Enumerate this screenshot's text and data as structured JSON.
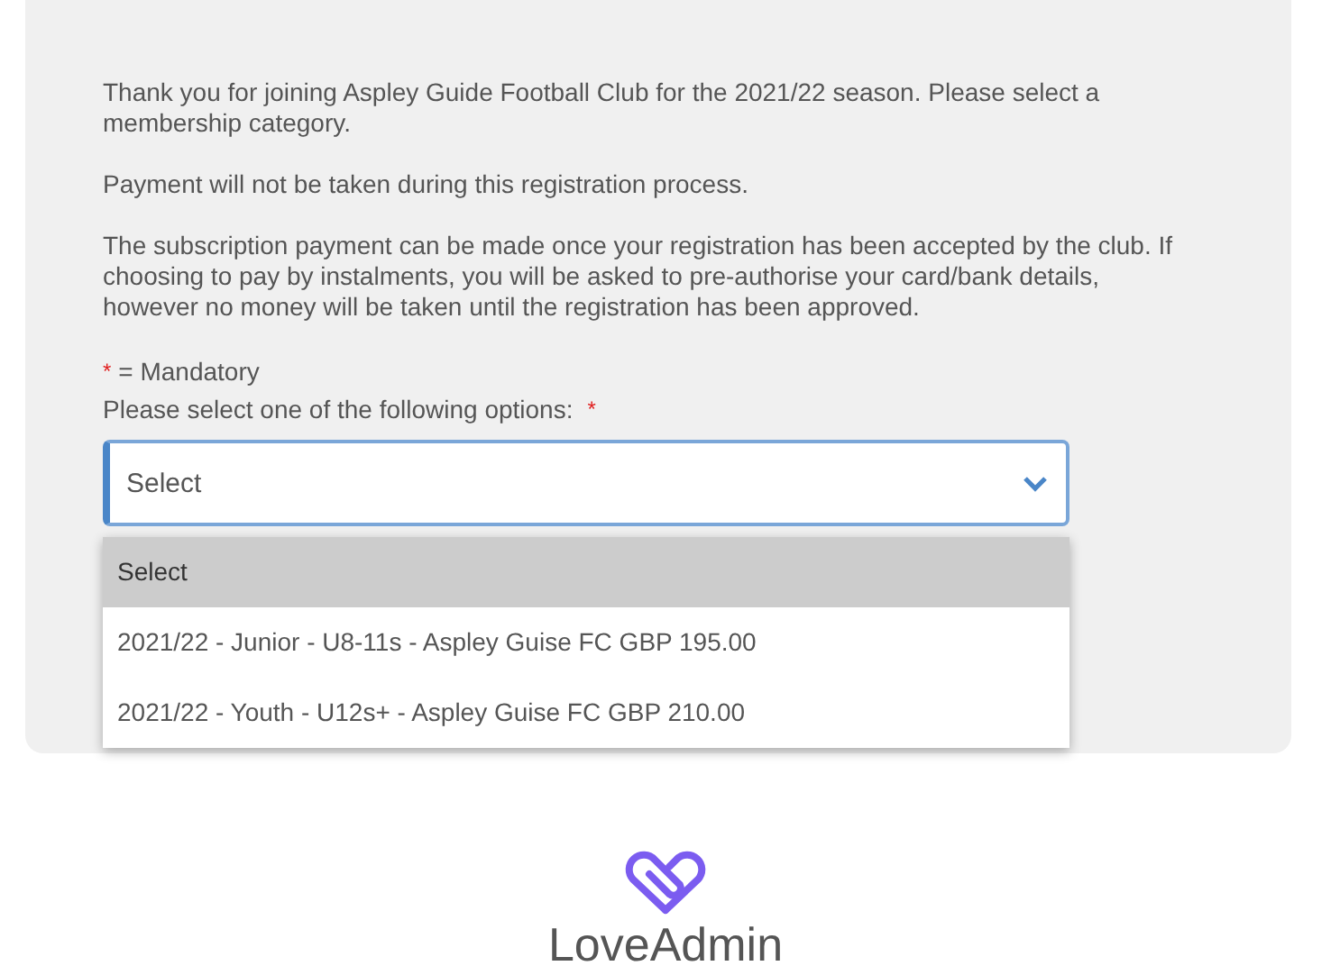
{
  "intro": [
    "Thank you for joining Aspley Guide Football Club for the 2021/22 season. Please select a membership category.",
    "Payment will not be taken during this registration process.",
    "The subscription payment can be made once your registration has been accepted by the club. If choosing to pay by instalments, you will be asked to pre-authorise your card/bank details, however no money will be taken until the registration has been approved."
  ],
  "mandatory_note": {
    "mark": "*",
    "text": "= Mandatory"
  },
  "field": {
    "label": "Please select one of the following options:",
    "required_mark": "*",
    "value": "Select",
    "expanded": true
  },
  "options": [
    {
      "label": "Select",
      "selected": true
    },
    {
      "label": "2021/22 - Junior - U8-11s - Aspley Guise FC GBP 195.00",
      "selected": false
    },
    {
      "label": "2021/22 - Youth - U12s+ - Aspley Guise FC GBP 210.00",
      "selected": false
    }
  ],
  "footer": {
    "brand": "LoveAdmin"
  }
}
